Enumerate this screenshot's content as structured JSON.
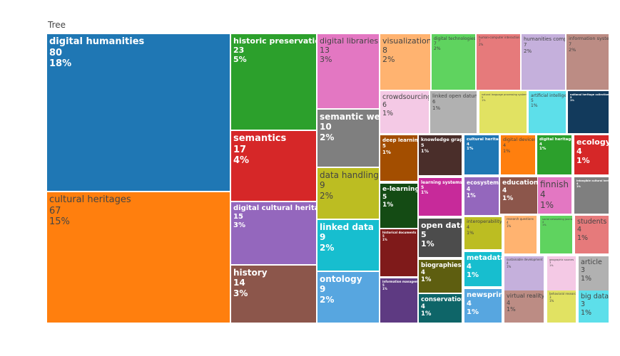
{
  "chart_data": {
    "type": "treemap",
    "title": "Tree",
    "items": [
      {
        "label": "digital humanities",
        "value": 80,
        "percent": "18%",
        "color": "#1f77b4"
      },
      {
        "label": "cultural heritages",
        "value": 67,
        "percent": "15%",
        "color": "#ff7f0e"
      },
      {
        "label": "historic preservation",
        "value": 23,
        "percent": "5%",
        "color": "#2ca02c"
      },
      {
        "label": "semantics",
        "value": 17,
        "percent": "4%",
        "color": "#d62728"
      },
      {
        "label": "digital cultural heritages",
        "value": 15,
        "percent": "3%",
        "color": "#9467bd"
      },
      {
        "label": "history",
        "value": 14,
        "percent": "3%",
        "color": "#8c564b"
      },
      {
        "label": "digital libraries",
        "value": 13,
        "percent": "3%",
        "color": "#e377c2"
      },
      {
        "label": "semantic web",
        "value": 10,
        "percent": "2%",
        "color": "#7f7f7f"
      },
      {
        "label": "data handling",
        "value": 9,
        "percent": "2%",
        "color": "#bcbd22"
      },
      {
        "label": "linked data",
        "value": 9,
        "percent": "2%",
        "color": "#17becf"
      },
      {
        "label": "ontology",
        "value": 9,
        "percent": "2%",
        "color": "#57a6e0"
      },
      {
        "label": "visualization",
        "value": 8,
        "percent": "2%",
        "color": "#ffb370"
      },
      {
        "label": "digital technologies",
        "value": 7,
        "percent": "2%",
        "color": "#5fd35f"
      },
      {
        "label": "human-computer interaction",
        "value": 7,
        "percent": "2%",
        "color": "#e67a7b"
      },
      {
        "label": "humanities computing",
        "value": 7,
        "percent": "2%",
        "color": "#c5b0dc"
      },
      {
        "label": "information systems",
        "value": 7,
        "percent": "2%",
        "color": "#bc8c84"
      },
      {
        "label": "crowdsourcing",
        "value": 6,
        "percent": "1%",
        "color": "#f4c9e5"
      },
      {
        "label": "linked open datum",
        "value": 6,
        "percent": "1%",
        "color": "#b1b1b1"
      },
      {
        "label": "natural language processing systems",
        "value": 5,
        "percent": "1%",
        "color": "#e1e262"
      },
      {
        "label": "artificial intelligence",
        "value": 5,
        "percent": "1%",
        "color": "#5ddfea"
      },
      {
        "label": "national heritage collections",
        "value": 5,
        "percent": "1%",
        "color": "#123a5c"
      },
      {
        "label": "deep learning",
        "value": 5,
        "percent": "1%",
        "color": "#a34e00"
      },
      {
        "label": "knowledge graphs",
        "value": 5,
        "percent": "1%",
        "color": "#4a2e2a"
      },
      {
        "label": "cultural heritage",
        "value": 4,
        "percent": "1%",
        "color": "#1f77b4"
      },
      {
        "label": "digital devices",
        "value": 4,
        "percent": "1%",
        "color": "#ff7f0e"
      },
      {
        "label": "digital heritage",
        "value": 4,
        "percent": "1%",
        "color": "#2ca02c"
      },
      {
        "label": "ecology",
        "value": 4,
        "percent": "1%",
        "color": "#d62728"
      },
      {
        "label": "e-learning",
        "value": 5,
        "percent": "1%",
        "color": "#144b14"
      },
      {
        "label": "learning systems",
        "value": 5,
        "percent": "1%",
        "color": "#c72a9a"
      },
      {
        "label": "ecosystems",
        "value": 4,
        "percent": "1%",
        "color": "#9467bd"
      },
      {
        "label": "education",
        "value": 4,
        "percent": "1%",
        "color": "#8c564b"
      },
      {
        "label": "finnish",
        "value": 4,
        "percent": "1%",
        "color": "#e377c2"
      },
      {
        "label": "intangible cultural heritages",
        "value": 4,
        "percent": "1%",
        "color": "#7f7f7f"
      },
      {
        "label": "historical documents",
        "value": 5,
        "percent": "1%",
        "color": "#7f1a1a"
      },
      {
        "label": "open data",
        "value": 5,
        "percent": "1%",
        "color": "#4c4c4c"
      },
      {
        "label": "interoperability",
        "value": 4,
        "percent": "1%",
        "color": "#bcbd22"
      },
      {
        "label": "research questions",
        "value": 4,
        "percent": "1%",
        "color": "#ffb370"
      },
      {
        "label": "social networking journey",
        "value": 4,
        "percent": "1%",
        "color": "#5fd35f"
      },
      {
        "label": "students",
        "value": 4,
        "percent": "1%",
        "color": "#e67a7b"
      },
      {
        "label": "information management",
        "value": 5,
        "percent": "1%",
        "color": "#5e3a82"
      },
      {
        "label": "biographies",
        "value": 4,
        "percent": "1%",
        "color": "#5e5e10"
      },
      {
        "label": "metadata",
        "value": 4,
        "percent": "1%",
        "color": "#17becf"
      },
      {
        "label": "sustainable development",
        "value": 4,
        "percent": "1%",
        "color": "#c5b0dc"
      },
      {
        "label": "geographic sources",
        "value": 3,
        "percent": "1%",
        "color": "#f4c9e5"
      },
      {
        "label": "article",
        "value": 3,
        "percent": "1%",
        "color": "#b1b1b1"
      },
      {
        "label": "conservation",
        "value": 4,
        "percent": "1%",
        "color": "#0e6568"
      },
      {
        "label": "newsprint",
        "value": 4,
        "percent": "1%",
        "color": "#57a6e0"
      },
      {
        "label": "virtual reality",
        "value": 4,
        "percent": "1%",
        "color": "#bc8c84"
      },
      {
        "label": "behavioral research",
        "value": 3,
        "percent": "1%",
        "color": "#e1e262"
      },
      {
        "label": "big data",
        "value": 3,
        "percent": "1%",
        "color": "#5ddfea"
      }
    ]
  }
}
